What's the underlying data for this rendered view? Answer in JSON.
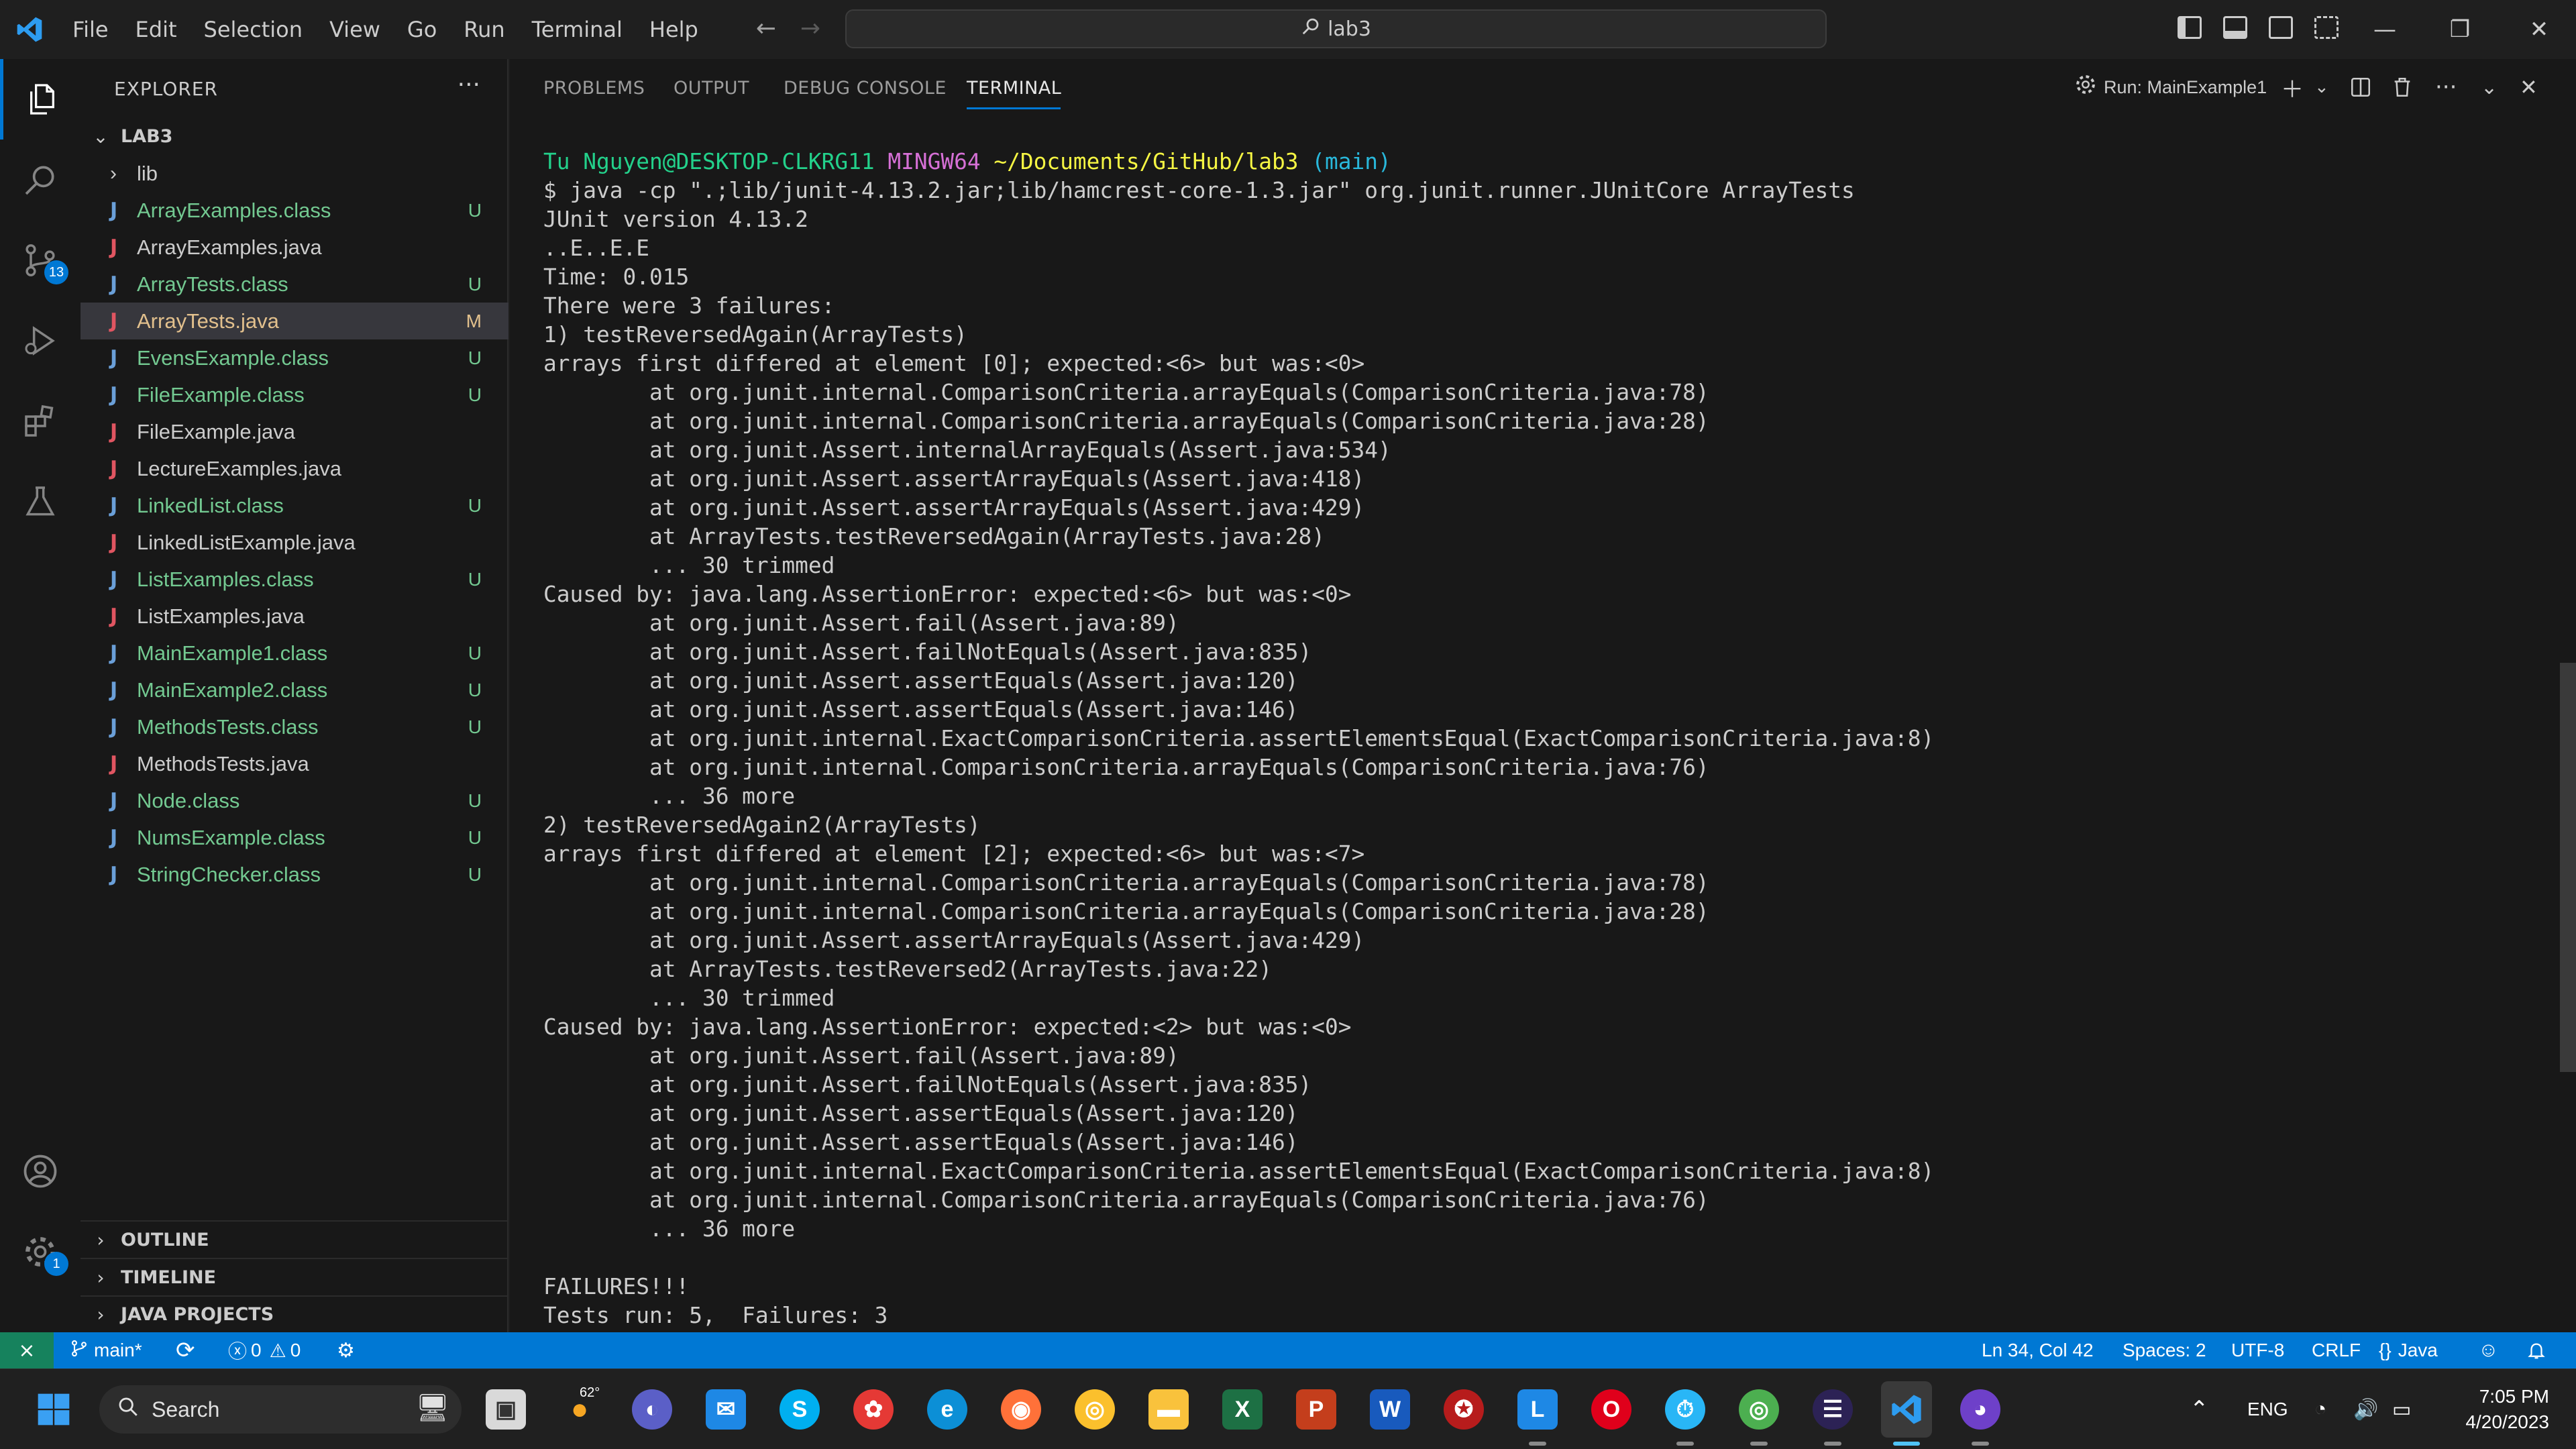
{
  "titlebar": {
    "menus": [
      "File",
      "Edit",
      "Selection",
      "View",
      "Go",
      "Run",
      "Terminal",
      "Help"
    ],
    "search_text": "lab3",
    "accent": "#0078d4"
  },
  "activity": {
    "scm_badge": "13",
    "settings_badge": "1"
  },
  "explorer": {
    "title": "EXPLORER",
    "folder": "LAB3",
    "lib_folder": "lib",
    "files": [
      {
        "name": "ArrayExamples.class",
        "status": "U",
        "tone": "green"
      },
      {
        "name": "ArrayExamples.java",
        "status": "",
        "tone": "plain"
      },
      {
        "name": "ArrayTests.class",
        "status": "U",
        "tone": "green"
      },
      {
        "name": "ArrayTests.java",
        "status": "M",
        "tone": "mod"
      },
      {
        "name": "EvensExample.class",
        "status": "U",
        "tone": "green"
      },
      {
        "name": "FileExample.class",
        "status": "U",
        "tone": "green"
      },
      {
        "name": "FileExample.java",
        "status": "",
        "tone": "plain"
      },
      {
        "name": "LectureExamples.java",
        "status": "",
        "tone": "plain"
      },
      {
        "name": "LinkedList.class",
        "status": "U",
        "tone": "green"
      },
      {
        "name": "LinkedListExample.java",
        "status": "",
        "tone": "plain"
      },
      {
        "name": "ListExamples.class",
        "status": "U",
        "tone": "green"
      },
      {
        "name": "ListExamples.java",
        "status": "",
        "tone": "plain"
      },
      {
        "name": "MainExample1.class",
        "status": "U",
        "tone": "green"
      },
      {
        "name": "MainExample2.class",
        "status": "U",
        "tone": "green"
      },
      {
        "name": "MethodsTests.class",
        "status": "U",
        "tone": "green"
      },
      {
        "name": "MethodsTests.java",
        "status": "",
        "tone": "plain"
      },
      {
        "name": "Node.class",
        "status": "U",
        "tone": "green"
      },
      {
        "name": "NumsExample.class",
        "status": "U",
        "tone": "green"
      },
      {
        "name": "StringChecker.class",
        "status": "U",
        "tone": "green"
      }
    ],
    "sections": [
      "OUTLINE",
      "TIMELINE",
      "JAVA PROJECTS"
    ]
  },
  "panel": {
    "tabs": [
      "PROBLEMS",
      "OUTPUT",
      "DEBUG CONSOLE",
      "TERMINAL"
    ],
    "active_tab": "TERMINAL",
    "run_label": "Run: MainExample1"
  },
  "terminal": {
    "prompt_user": "Tu Nguyen@DESKTOP-CLKRG11",
    "prompt_env": "MINGW64",
    "prompt_path": "~/Documents/GitHub/lab3",
    "prompt_branch": "(main)",
    "lines": [
      "$ java -cp \".;lib/junit-4.13.2.jar;lib/hamcrest-core-1.3.jar\" org.junit.runner.JUnitCore ArrayTests",
      "JUnit version 4.13.2",
      "..E..E.E",
      "Time: 0.015",
      "There were 3 failures:",
      "1) testReversedAgain(ArrayTests)",
      "arrays first differed at element [0]; expected:<6> but was:<0>",
      "        at org.junit.internal.ComparisonCriteria.arrayEquals(ComparisonCriteria.java:78)",
      "        at org.junit.internal.ComparisonCriteria.arrayEquals(ComparisonCriteria.java:28)",
      "        at org.junit.Assert.internalArrayEquals(Assert.java:534)",
      "        at org.junit.Assert.assertArrayEquals(Assert.java:418)",
      "        at org.junit.Assert.assertArrayEquals(Assert.java:429)",
      "        at ArrayTests.testReversedAgain(ArrayTests.java:28)",
      "        ... 30 trimmed",
      "Caused by: java.lang.AssertionError: expected:<6> but was:<0>",
      "        at org.junit.Assert.fail(Assert.java:89)",
      "        at org.junit.Assert.failNotEquals(Assert.java:835)",
      "        at org.junit.Assert.assertEquals(Assert.java:120)",
      "        at org.junit.Assert.assertEquals(Assert.java:146)",
      "        at org.junit.internal.ExactComparisonCriteria.assertElementsEqual(ExactComparisonCriteria.java:8)",
      "        at org.junit.internal.ComparisonCriteria.arrayEquals(ComparisonCriteria.java:76)",
      "        ... 36 more",
      "2) testReversedAgain2(ArrayTests)",
      "arrays first differed at element [2]; expected:<6> but was:<7>",
      "        at org.junit.internal.ComparisonCriteria.arrayEquals(ComparisonCriteria.java:78)",
      "        at org.junit.internal.ComparisonCriteria.arrayEquals(ComparisonCriteria.java:28)",
      "        at org.junit.Assert.assertArrayEquals(Assert.java:429)",
      "        at ArrayTests.testReversed2(ArrayTests.java:22)",
      "        ... 30 trimmed",
      "Caused by: java.lang.AssertionError: expected:<2> but was:<0>",
      "        at org.junit.Assert.fail(Assert.java:89)",
      "        at org.junit.Assert.failNotEquals(Assert.java:835)",
      "        at org.junit.Assert.assertEquals(Assert.java:120)",
      "        at org.junit.Assert.assertEquals(Assert.java:146)",
      "        at org.junit.internal.ExactComparisonCriteria.assertElementsEqual(ExactComparisonCriteria.java:8)",
      "        at org.junit.internal.ComparisonCriteria.arrayEquals(ComparisonCriteria.java:76)",
      "        ... 36 more",
      "",
      "FAILURES!!!",
      "Tests run: 5,  Failures: 3"
    ]
  },
  "statusbar": {
    "branch": "main*",
    "errors": "0",
    "warnings": "0",
    "position": "Ln 34, Col 42",
    "spaces": "Spaces: 2",
    "encoding": "UTF-8",
    "eol": "CRLF",
    "language": "Java"
  },
  "taskbar": {
    "search_label": "Search",
    "weather": "62°",
    "language": "ENG",
    "time": "7:05 PM",
    "date": "4/20/2023"
  }
}
